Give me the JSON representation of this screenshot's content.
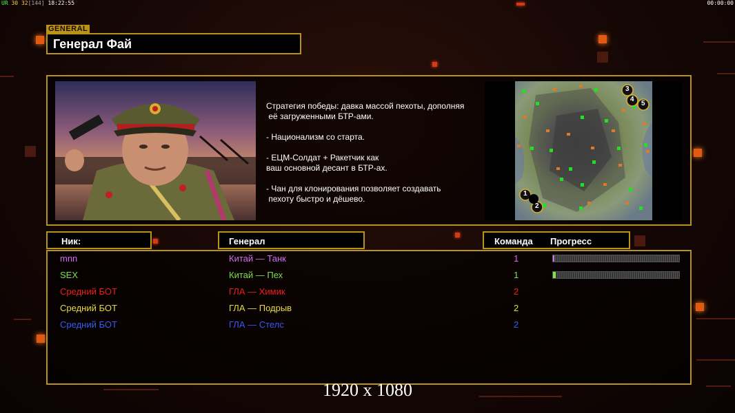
{
  "hud": {
    "fps_prefix": "UR",
    "fps": "30",
    "fps2": "32",
    "count": "[144]",
    "clock": "18:22:55",
    "timer": "00:00:00"
  },
  "general_tag": "GENERAL",
  "title": "Генерал Фай",
  "description": "Стратегия победы: давка массой пехоты, дополняя\n её загруженными БТР-ами.\n\n- Национализм со старта.\n\n- ЕЦМ-Солдат + Ракетчик как\nваш основной десант в БТР-ах.\n\n- Чан для клонирования позволяет создавать\n пехоту быстро и дёшево.",
  "map": {
    "start_positions": [
      "1",
      "2",
      "3",
      "4",
      "5"
    ]
  },
  "table": {
    "headers": {
      "nick": "Ник:",
      "general": "Генерал",
      "team": "Команда",
      "progress": "Прогресс"
    },
    "rows": [
      {
        "nick": "mnn",
        "general": "Китай — Танк",
        "team": "1",
        "color": "#d26cf0",
        "progress": 0.01
      },
      {
        "nick": "SEX",
        "general": "Китай — Пех",
        "team": "1",
        "color": "#7ee04a",
        "progress": 0.02
      },
      {
        "nick": "Средний БОТ",
        "general": "ГЛА — Химик",
        "team": "2",
        "color": "#f01e1e",
        "progress": null
      },
      {
        "nick": "Средний БОТ",
        "general": "ГЛА — Подрыв",
        "team": "2",
        "color": "#e8dc3a",
        "progress": null
      },
      {
        "nick": "Средний БОТ",
        "general": "ГЛА — Стелс",
        "team": "2",
        "color": "#3a5af0",
        "progress": null
      }
    ]
  },
  "resolution_label": "1920 x 1080",
  "colors": {
    "gold_border": "#b89318",
    "accent_orange": "#e05a12"
  }
}
